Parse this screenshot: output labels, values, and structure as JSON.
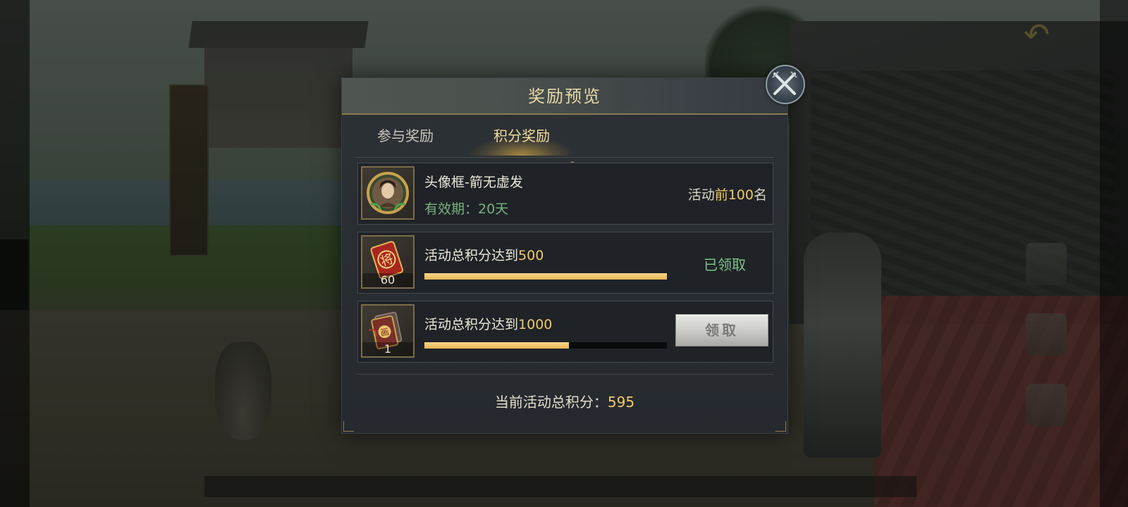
{
  "dialog": {
    "title": "奖励预览",
    "tabs": [
      {
        "label": "参与奖励",
        "selected": false
      },
      {
        "label": "积分奖励",
        "selected": true
      }
    ]
  },
  "rewards": [
    {
      "item_name": "头像框-箭无虚发",
      "validity": "有效期：20天",
      "rank_prefix": "活动",
      "rank_highlight": "前100",
      "rank_suffix": "名",
      "icon": "avatar-frame-portrait-icon"
    },
    {
      "requirement": "活动总积分达到",
      "threshold": "500",
      "item_count": "60",
      "icon": "general-token-icon",
      "progress": 1.0,
      "status": "已领取"
    },
    {
      "requirement": "活动总积分达到",
      "threshold": "1000",
      "item_count": "1",
      "icon": "red-envelope-icon",
      "progress": 0.595,
      "button": "领取"
    }
  ],
  "total": {
    "label": "当前活动总积分：",
    "value": "595"
  },
  "colors": {
    "highlight": "#f1c96a",
    "claimed": "#7ec28a",
    "validity": "#79b27f",
    "title": "#e9d8a6"
  }
}
